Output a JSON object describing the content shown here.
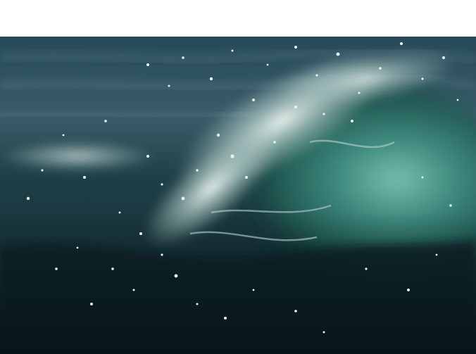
{
  "image": {
    "subject": "breaking-ocean-wave-with-spray",
    "palette": {
      "deep_water": "#0b1f22",
      "mid_teal": "#2f6f6a",
      "light_teal": "#6fb3a6",
      "dark_blue_sea": "#1e3f4e",
      "spray_white": "#e8f2ee",
      "foam_gray": "#a9c3c2"
    }
  }
}
